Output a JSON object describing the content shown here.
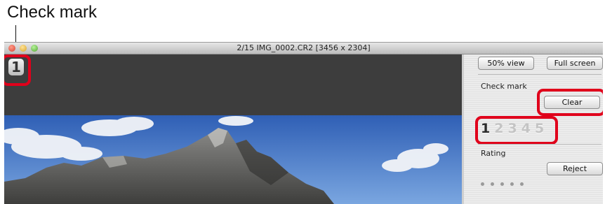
{
  "callout": {
    "label": "Check mark"
  },
  "window": {
    "title": "2/15 IMG_0002.CR2 [3456 x 2304]",
    "check_badge": "1"
  },
  "panel": {
    "view_50_label": "50% view",
    "full_screen_label": "Full screen",
    "check_mark_heading": "Check mark",
    "clear_label": "Clear",
    "check_marks": [
      "1",
      "2",
      "3",
      "4",
      "5"
    ],
    "active_check_mark": "1",
    "rating_heading": "Rating",
    "reject_label": "Reject",
    "rating_dots": 5
  },
  "colors": {
    "highlight": "#e0001b",
    "sky": "#4a78c4",
    "dark_bg": "#3d3d3d"
  }
}
